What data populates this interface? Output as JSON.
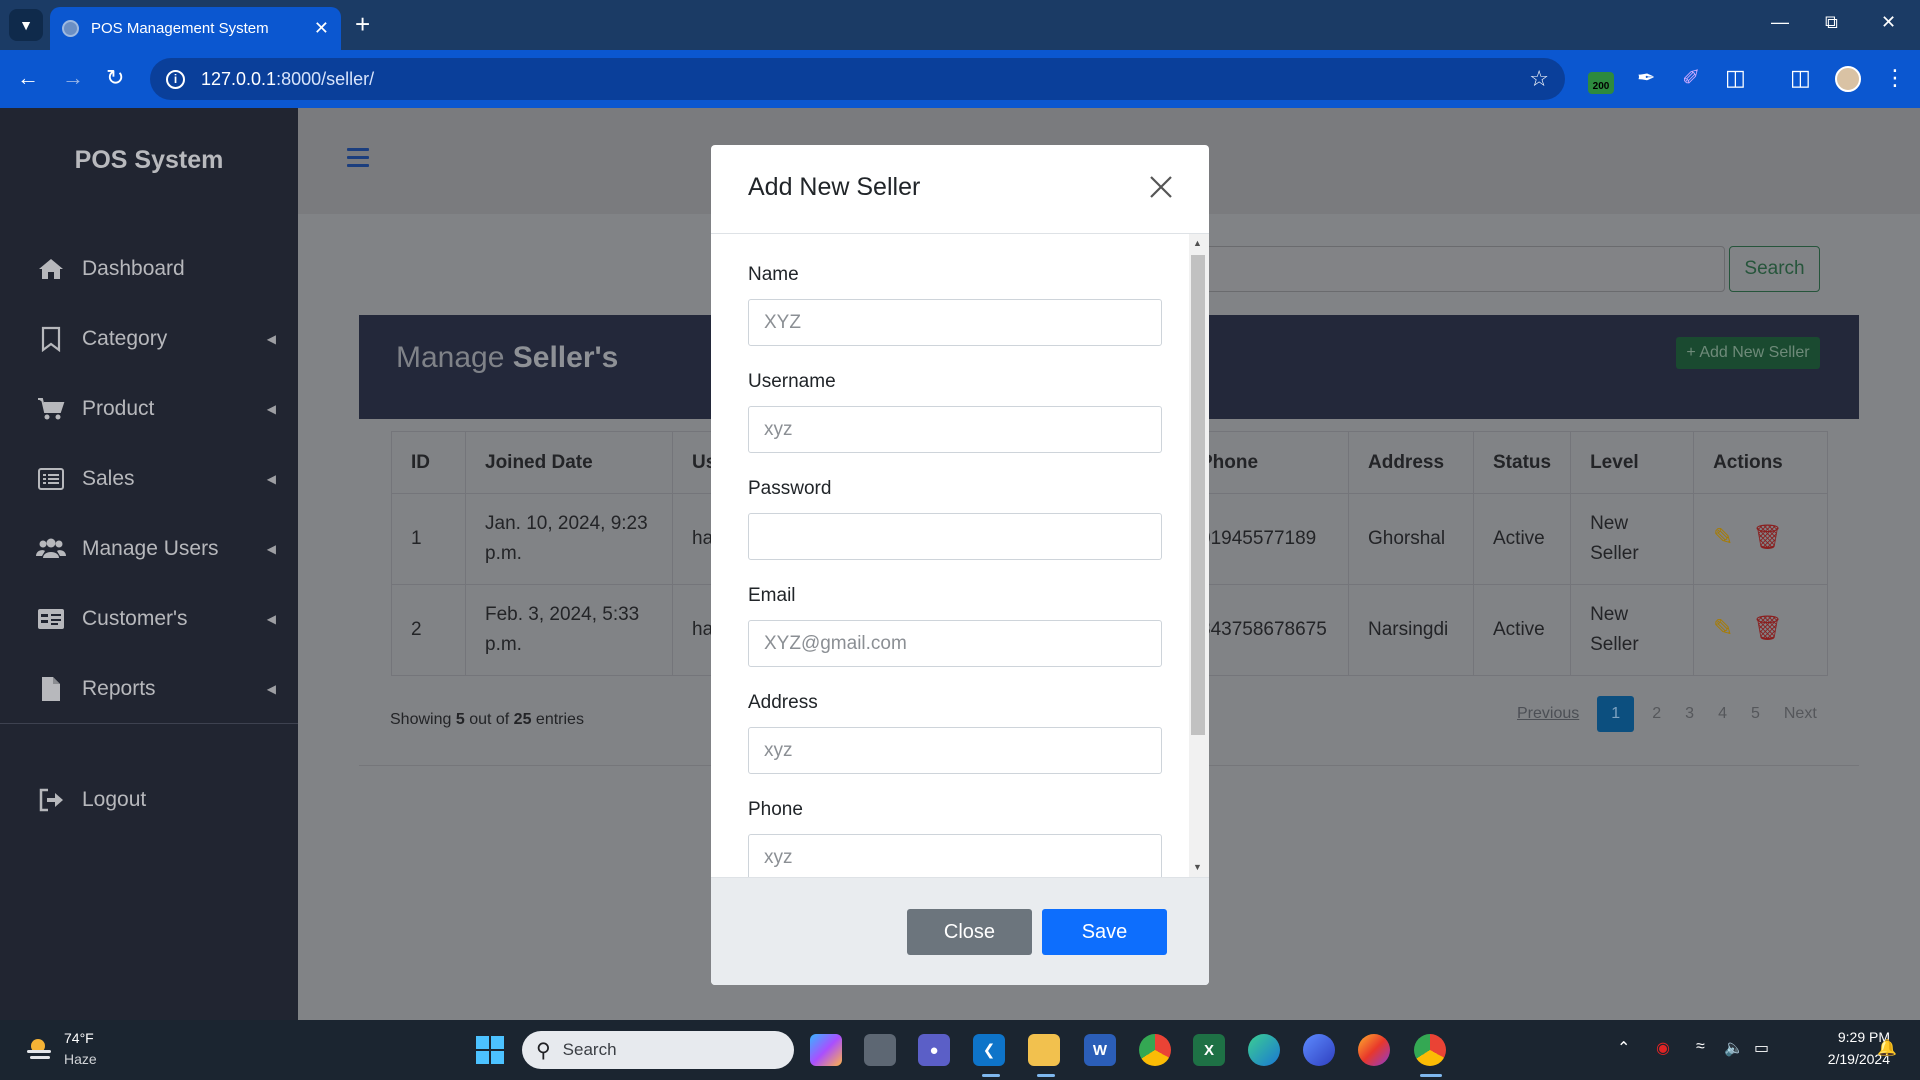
{
  "browser": {
    "tab_title": "POS Management System",
    "url_host": "127.0.0.1",
    "url_path": ":8000/seller/",
    "ext_badge": "200"
  },
  "sidebar": {
    "brand": "POS System",
    "items": [
      {
        "label": "Dashboard",
        "icon": "home-icon"
      },
      {
        "label": "Category",
        "icon": "bookmark-icon"
      },
      {
        "label": "Product",
        "icon": "cart-icon"
      },
      {
        "label": "Sales",
        "icon": "list-card-icon"
      },
      {
        "label": "Manage Users",
        "icon": "users-icon"
      },
      {
        "label": "Customer's",
        "icon": "id-card-icon"
      },
      {
        "label": "Reports",
        "icon": "file-icon"
      },
      {
        "label": "Logout",
        "icon": "logout-icon"
      }
    ]
  },
  "main": {
    "search_button": "Search",
    "title_prefix": "Manage",
    "title_bold": "Seller's",
    "add_new_button": "+ Add New Seller",
    "table": {
      "headers": [
        "ID",
        "Joined Date",
        "Us",
        "Phone",
        "Address",
        "Status",
        "Level",
        "Actions"
      ],
      "rows": [
        {
          "id": "1",
          "joined": "Jan. 10, 2024, 9:23 p.m.",
          "user": "ha",
          "phone": "01945577189",
          "address": "Ghorshal",
          "status": "Active",
          "level": "New Seller"
        },
        {
          "id": "2",
          "joined": "Feb. 3, 2024, 5:33 p.m.",
          "user": "ha",
          "phone": "843758678675",
          "address": "Narsingdi",
          "status": "Active",
          "level": "New Seller"
        }
      ]
    },
    "showing": {
      "prefix": "Showing",
      "count": "5",
      "mid": "out of",
      "total": "25",
      "suffix": "entries"
    },
    "pagination": {
      "previous": "Previous",
      "pages": [
        "1",
        "2",
        "3",
        "4",
        "5"
      ],
      "next": "Next",
      "current": "1"
    }
  },
  "modal": {
    "title": "Add New Seller",
    "fields": [
      {
        "label": "Name",
        "placeholder": "XYZ"
      },
      {
        "label": "Username",
        "placeholder": "xyz"
      },
      {
        "label": "Password",
        "placeholder": ""
      },
      {
        "label": "Email",
        "placeholder": "XYZ@gmail.com"
      },
      {
        "label": "Address",
        "placeholder": "xyz"
      },
      {
        "label": "Phone",
        "placeholder": "xyz"
      }
    ],
    "close_button": "Close",
    "save_button": "Save"
  },
  "taskbar": {
    "weather_temp": "74°F",
    "weather_desc": "Haze",
    "search_placeholder": "Search",
    "time": "9:29 PM",
    "date": "2/19/2024"
  }
}
